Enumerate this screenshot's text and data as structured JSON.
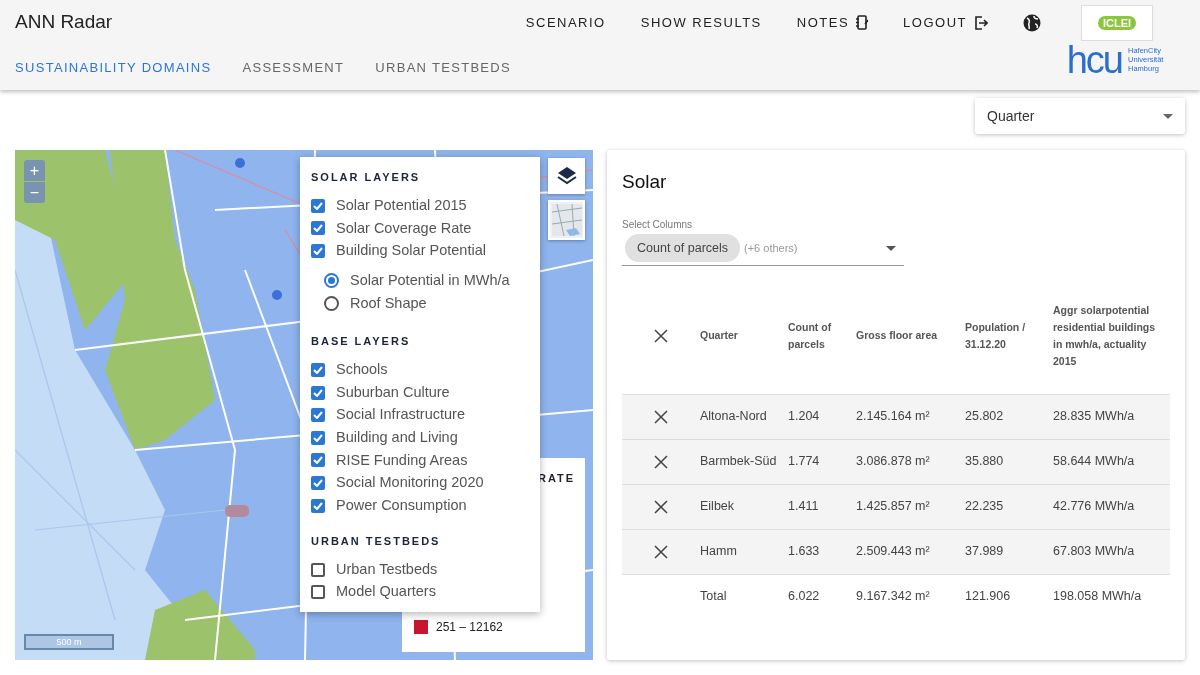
{
  "header": {
    "title": "ANN Radar",
    "nav": [
      {
        "label": "SCENARIO",
        "kind": "plain"
      },
      {
        "label": "SHOW RESULTS",
        "kind": "plain"
      },
      {
        "label": "NOTES",
        "kind": "notes"
      },
      {
        "label": "LOGOUT",
        "kind": "logout"
      }
    ],
    "logos": {
      "iclei": "ICLEI",
      "hcu": "hcu",
      "hcu_sub": "HafenCity Universität Hamburg"
    }
  },
  "tabs": [
    {
      "label": "SUSTAINABILITY DOMAINS",
      "selected": true
    },
    {
      "label": "ASSESSMENT",
      "selected": false
    },
    {
      "label": "URBAN TESTBEDS",
      "selected": false
    }
  ],
  "region_select": {
    "value": "Quarter"
  },
  "map": {
    "zoom_in": "+",
    "zoom_out": "−",
    "scale": "500 m",
    "legend": {
      "title": "RATE",
      "entries": [
        {
          "label": "251 – 12162",
          "color": "#c8142e"
        }
      ]
    },
    "layers": [
      {
        "title": "SOLAR LAYERS",
        "items": [
          {
            "label": "Solar Potential 2015",
            "checked": true
          },
          {
            "label": "Solar Coverage Rate",
            "checked": true
          },
          {
            "label": "Building Solar Potential",
            "checked": true,
            "options": [
              {
                "label": "Solar Potential in MWh/a",
                "selected": true
              },
              {
                "label": "Roof Shape",
                "selected": false
              }
            ]
          }
        ]
      },
      {
        "title": "BASE LAYERS",
        "items": [
          {
            "label": "Schools",
            "checked": true
          },
          {
            "label": "Suburban Culture",
            "checked": true
          },
          {
            "label": "Social Infrastructure",
            "checked": true
          },
          {
            "label": "Building and Living",
            "checked": true
          },
          {
            "label": "RISE Funding Areas",
            "checked": true
          },
          {
            "label": "Social Monitoring 2020",
            "checked": true
          },
          {
            "label": "Power Consumption",
            "checked": true
          }
        ]
      },
      {
        "title": "URBAN TESTBEDS",
        "items": [
          {
            "label": "Urban Testbeds",
            "checked": false
          },
          {
            "label": "Model Quarters",
            "checked": false
          }
        ]
      }
    ]
  },
  "panel": {
    "title": "Solar",
    "select": {
      "label": "Select Columns",
      "chip": "Count of parcels",
      "more": "(+6 others)"
    },
    "table": {
      "columns": [
        "Quarter",
        "Count of parcels",
        "Gross floor area",
        "Population / 31.12.20",
        "Aggr solarpotential residential buildings in mwh/a, actuality 2015"
      ],
      "rows": [
        {
          "cells": [
            "Altona-Nord",
            "1.204",
            "2.145.164 m²",
            "25.802",
            "28.835 MWh/a"
          ]
        },
        {
          "cells": [
            "Barmbek-Süd",
            "1.774",
            "3.086.878 m²",
            "35.880",
            "58.644 MWh/a"
          ]
        },
        {
          "cells": [
            "Eilbek",
            "1.411",
            "1.425.857 m²",
            "22.235",
            "42.776 MWh/a"
          ]
        },
        {
          "cells": [
            "Hamm",
            "1.633",
            "2.509.443 m²",
            "37.989",
            "67.803 MWh/a"
          ]
        }
      ],
      "total": [
        "Total",
        "6.022",
        "9.167.342 m²",
        "121.906",
        "198.058 MWh/a"
      ]
    }
  }
}
